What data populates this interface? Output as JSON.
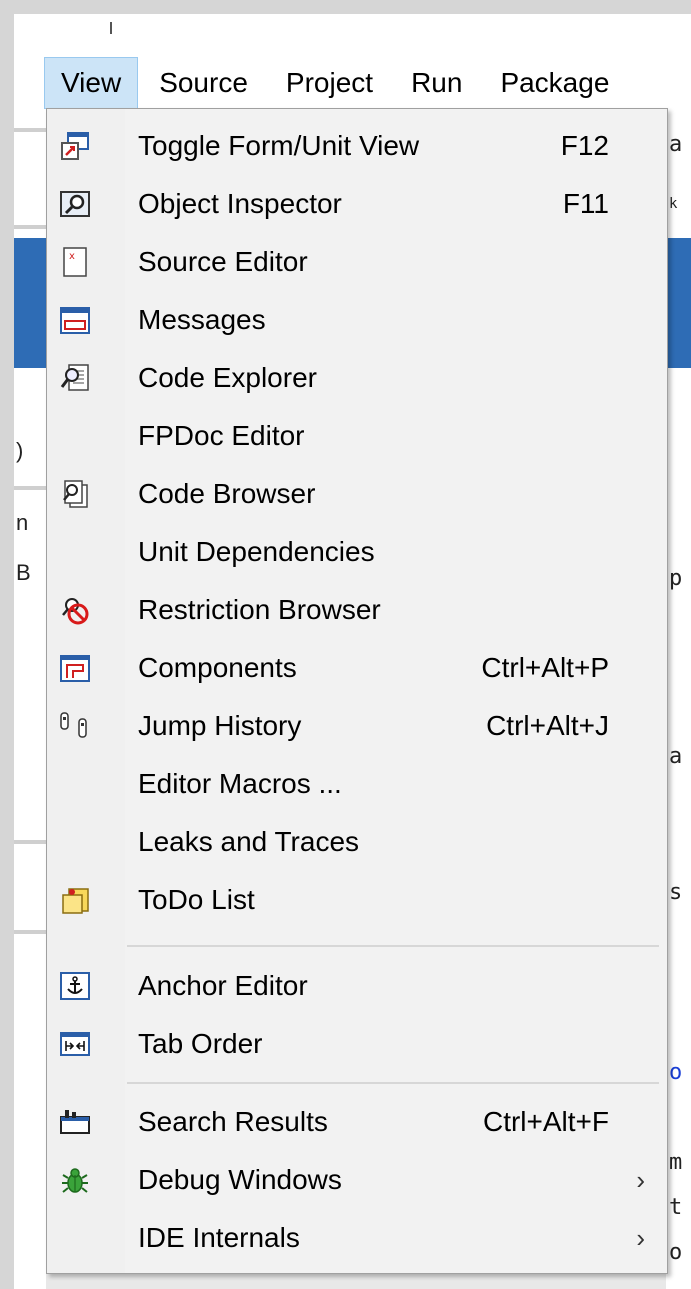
{
  "menubar": {
    "items": [
      {
        "label": "View",
        "active": true
      },
      {
        "label": "Source",
        "active": false
      },
      {
        "label": "Project",
        "active": false
      },
      {
        "label": "Run",
        "active": false
      },
      {
        "label": "Package",
        "active": false
      }
    ]
  },
  "view_menu": {
    "items": [
      {
        "label": "Toggle Form/Unit View",
        "shortcut": "F12",
        "icon": "toggle-form-unit-icon"
      },
      {
        "label": "Object Inspector",
        "shortcut": "F11",
        "icon": "object-inspector-icon"
      },
      {
        "label": "Source Editor",
        "shortcut": "",
        "icon": "source-editor-icon"
      },
      {
        "label": "Messages",
        "shortcut": "",
        "icon": "messages-icon"
      },
      {
        "label": "Code Explorer",
        "shortcut": "",
        "icon": "code-explorer-icon"
      },
      {
        "label": "FPDoc Editor",
        "shortcut": "",
        "icon": ""
      },
      {
        "label": "Code Browser",
        "shortcut": "",
        "icon": "code-browser-icon"
      },
      {
        "label": "Unit Dependencies",
        "shortcut": "",
        "icon": ""
      },
      {
        "label": "Restriction Browser",
        "shortcut": "",
        "icon": "restriction-browser-icon"
      },
      {
        "label": "Components",
        "shortcut": "Ctrl+Alt+P",
        "icon": "components-icon"
      },
      {
        "label": "Jump History",
        "shortcut": "Ctrl+Alt+J",
        "icon": "jump-history-icon"
      },
      {
        "label": "Editor Macros ...",
        "shortcut": "",
        "icon": ""
      },
      {
        "label": "Leaks and Traces",
        "shortcut": "",
        "icon": ""
      },
      {
        "label": "ToDo List",
        "shortcut": "",
        "icon": "todo-list-icon"
      },
      {
        "label": "Anchor Editor",
        "shortcut": "",
        "icon": "anchor-icon"
      },
      {
        "label": "Tab Order",
        "shortcut": "",
        "icon": "tab-order-icon"
      },
      {
        "label": "Search Results",
        "shortcut": "Ctrl+Alt+F",
        "icon": "search-results-icon"
      },
      {
        "label": "Debug Windows",
        "shortcut": "",
        "icon": "bug-icon",
        "submenu": true
      },
      {
        "label": "IDE Internals",
        "shortcut": "",
        "icon": "",
        "submenu": true
      }
    ],
    "submenu_glyph": "›"
  },
  "background": {
    "right_chars": [
      "a",
      "k",
      "p",
      "a",
      "s",
      "o",
      "m",
      "t",
      "o"
    ],
    "left_chars": [
      ")",
      "n",
      "B"
    ]
  },
  "colors": {
    "menu_bg": "#f2f2f2",
    "menubar_active_bg": "#cce4f7",
    "menubar_active_border": "#99c9ef",
    "ide_blue": "#2e6cb5"
  }
}
